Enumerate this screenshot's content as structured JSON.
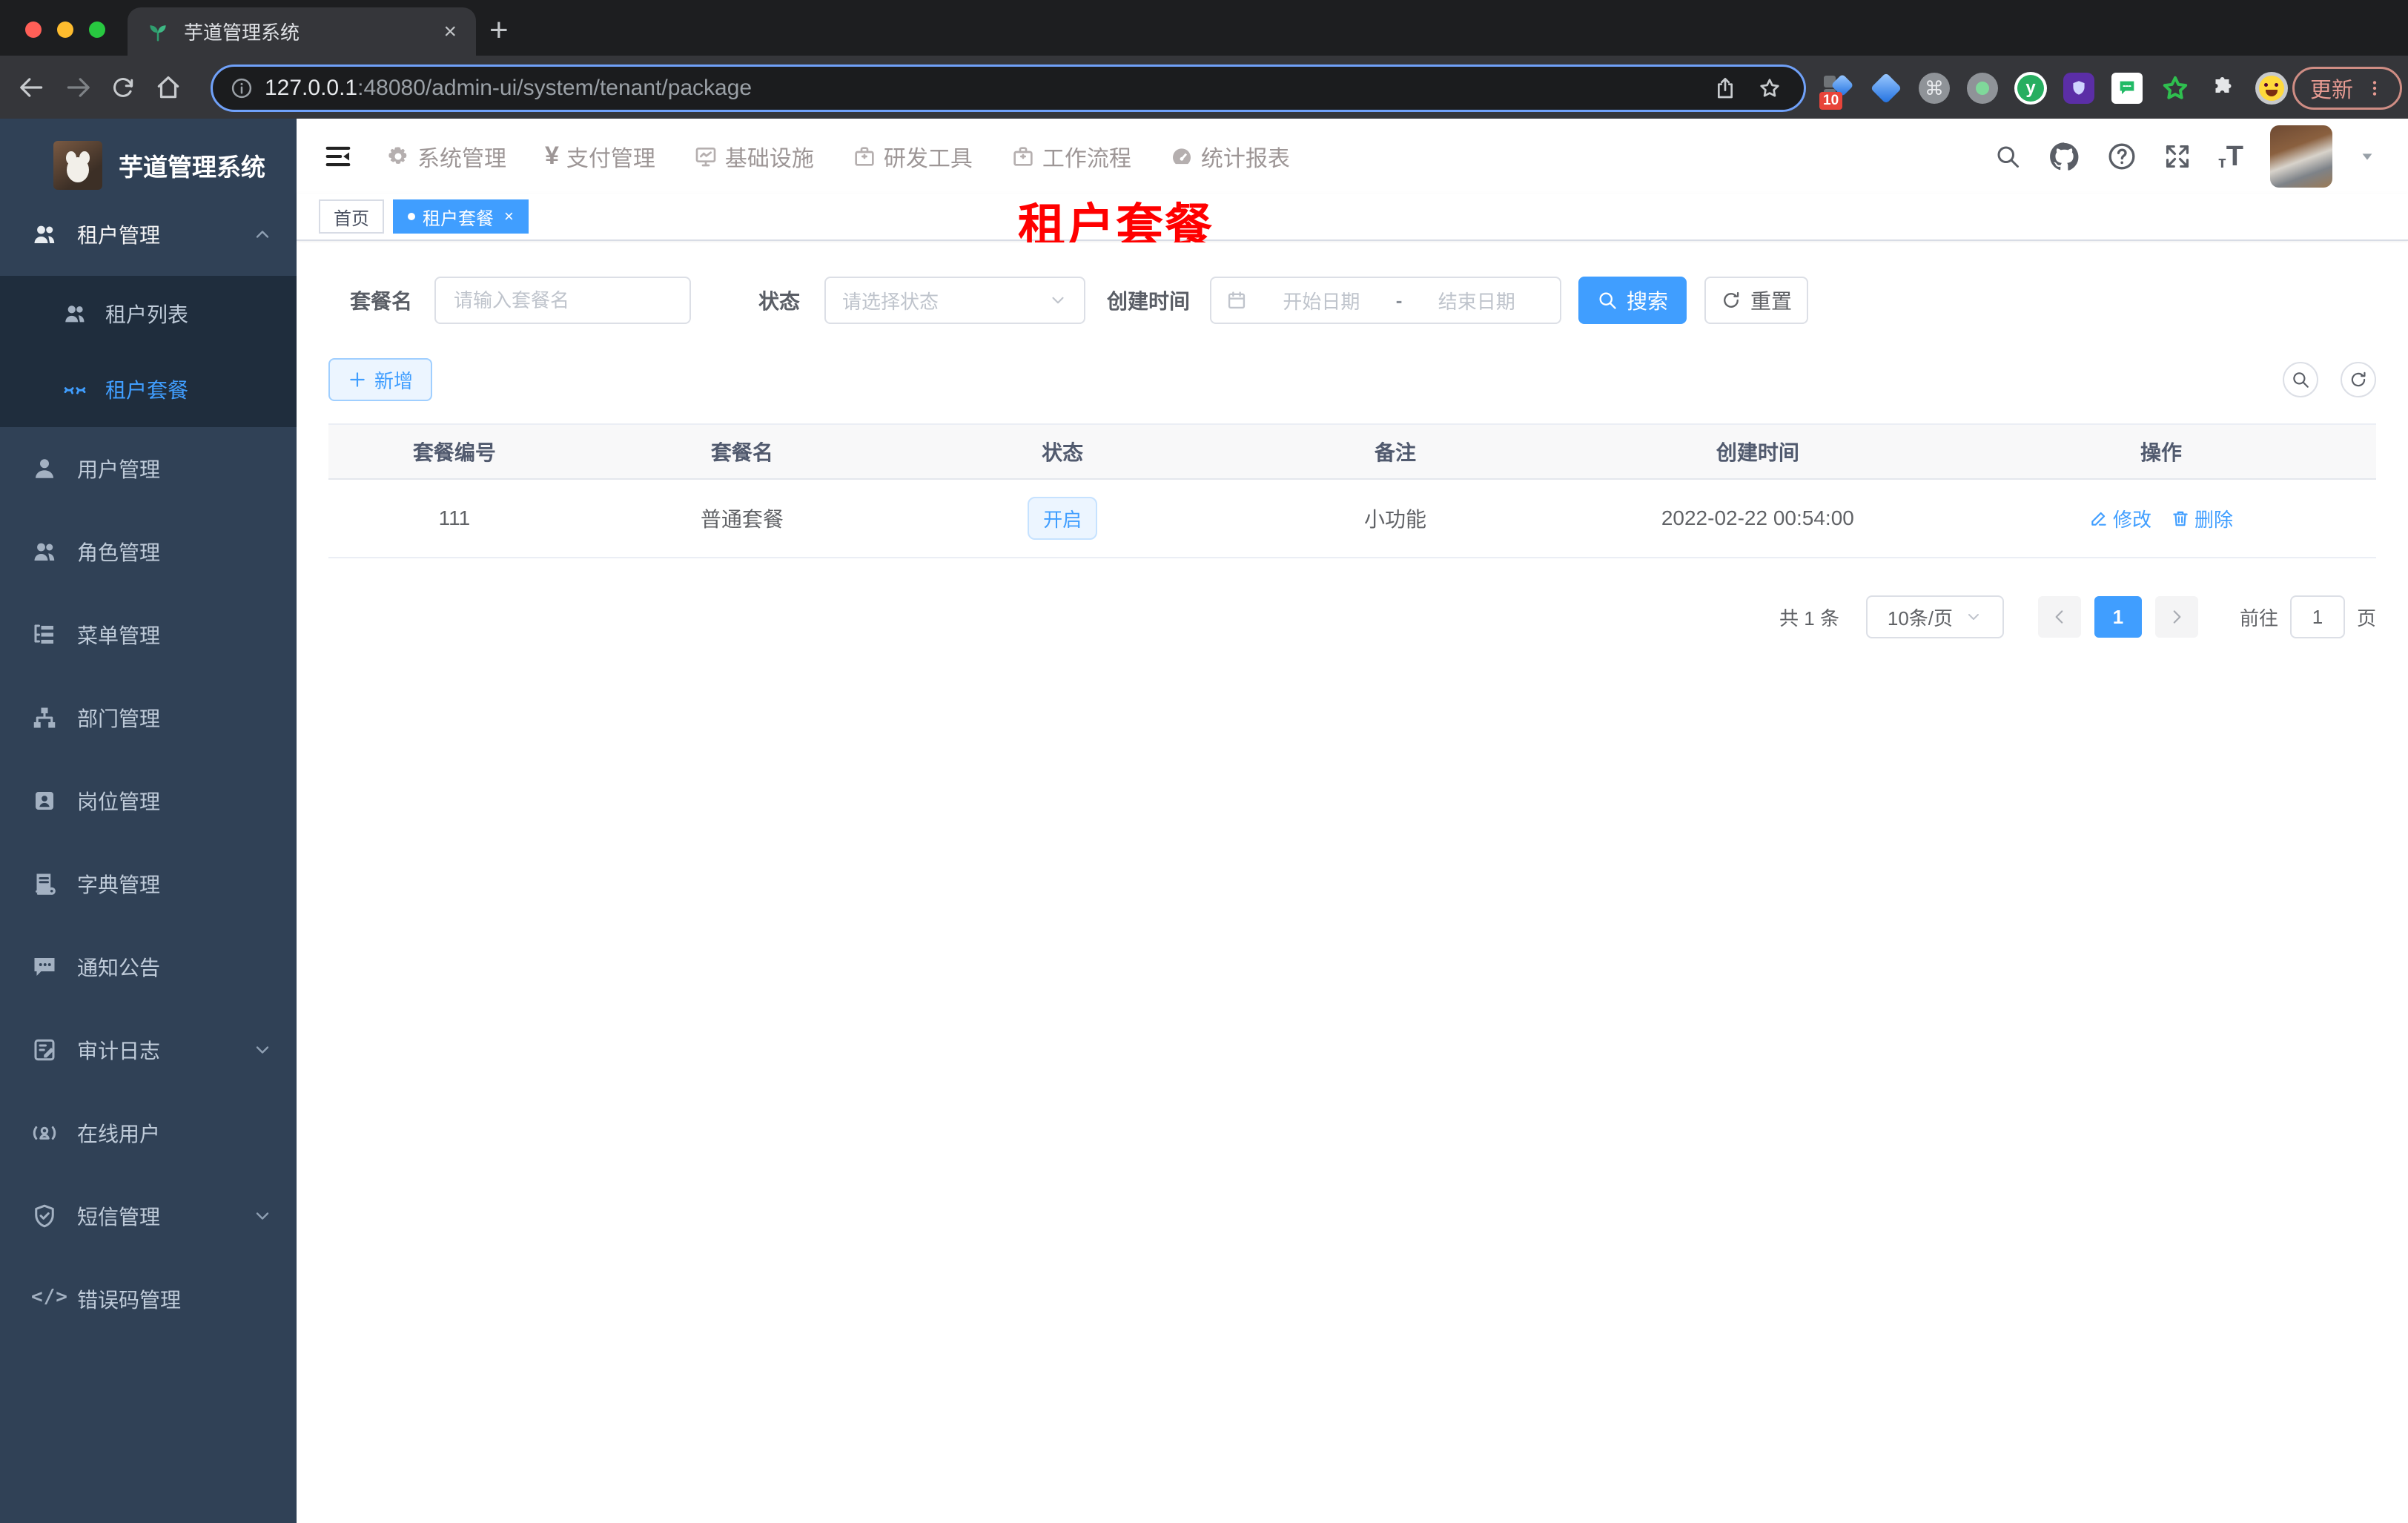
{
  "browser": {
    "tab_title": "芋道管理系统",
    "tab_close": "×",
    "new_tab": "+",
    "url_host": "127.0.0.1",
    "url_rest": ":48080/admin-ui/system/tenant/package",
    "ext_badge": "10",
    "ext_y_label": "y",
    "ext_cmd": "⌘",
    "update_label": "更新"
  },
  "app_title": "芋道管理系统",
  "sidebar": {
    "items": [
      {
        "label": "租户管理"
      },
      {
        "label": "租户列表"
      },
      {
        "label": "租户套餐"
      },
      {
        "label": "用户管理"
      },
      {
        "label": "角色管理"
      },
      {
        "label": "菜单管理"
      },
      {
        "label": "部门管理"
      },
      {
        "label": "岗位管理"
      },
      {
        "label": "字典管理"
      },
      {
        "label": "通知公告"
      },
      {
        "label": "审计日志"
      },
      {
        "label": "在线用户"
      },
      {
        "label": "短信管理"
      },
      {
        "label": "错误码管理"
      }
    ],
    "code_glyph": "</>"
  },
  "topnav": {
    "items": [
      {
        "label": "系统管理"
      },
      {
        "label": "支付管理"
      },
      {
        "label": "基础设施"
      },
      {
        "label": "研发工具"
      },
      {
        "label": "工作流程"
      },
      {
        "label": "统计报表"
      }
    ],
    "yen_glyph": "¥"
  },
  "tags": {
    "home": "首页",
    "active": "租户套餐",
    "close": "×"
  },
  "overlay_title": "租户套餐",
  "filters": {
    "name_label": "套餐名",
    "name_placeholder": "请输入套餐名",
    "status_label": "状态",
    "status_placeholder": "请选择状态",
    "date_label": "创建时间",
    "date_start_placeholder": "开始日期",
    "date_separator": "-",
    "date_end_placeholder": "结束日期",
    "search_label": "搜索",
    "reset_label": "重置"
  },
  "toolbar": {
    "add_label": "新增"
  },
  "table": {
    "headers": [
      "套餐编号",
      "套餐名",
      "状态",
      "备注",
      "创建时间",
      "操作"
    ],
    "rows": [
      {
        "package_id": "111",
        "name": "普通套餐",
        "status": "开启",
        "remark": "小功能",
        "created_at": "2022-02-22 00:54:00",
        "edit_label": "修改",
        "delete_label": "删除"
      }
    ]
  },
  "pagination": {
    "total": "共 1 条",
    "page_size": "10条/页",
    "current_page": "1",
    "goto_label": "前往",
    "goto_value": "1",
    "page_unit": "页"
  },
  "colors": {
    "accent": "#409eff",
    "sidebar_bg": "#304156",
    "submenu_bg": "#1f2d3d",
    "sidebar_text": "#bfcbd9",
    "overlay_red": "#ff0000",
    "status_tag_bg": "#ecf5ff",
    "status_tag_text": "#409eff",
    "update_pill": "#cf8d84"
  }
}
